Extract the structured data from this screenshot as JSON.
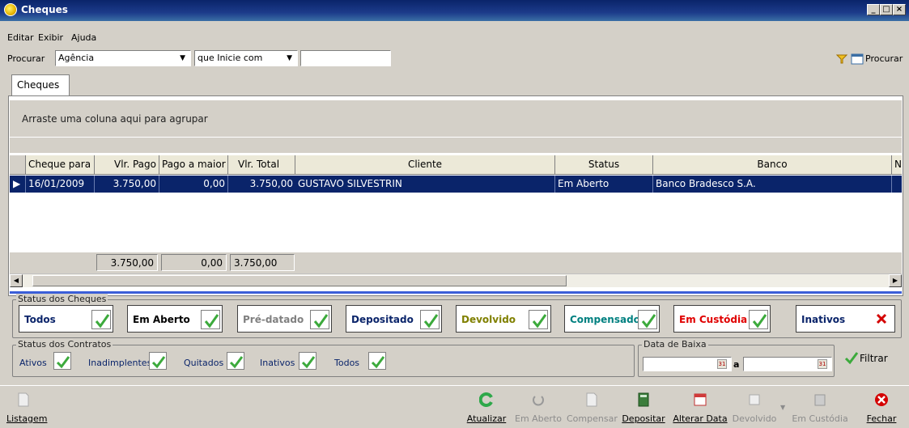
{
  "window": {
    "title": "Cheques",
    "controls": [
      "_",
      "□",
      "×"
    ]
  },
  "menu": [
    "Editar",
    "Exibir",
    "Ajuda"
  ],
  "search": {
    "label": "Procurar",
    "field": "Agência",
    "condition": "que Inicie com",
    "value": "",
    "button": "Procurar"
  },
  "tabs": [
    "Cheques"
  ],
  "grid": {
    "group_hint": "Arraste uma coluna aqui para agrupar",
    "columns": [
      "Cheque para",
      "Vlr. Pago",
      "Pago a maior",
      "Vlr. Total",
      "Cliente",
      "Status",
      "Banco",
      "N"
    ],
    "rows": [
      {
        "cheque_para": "16/01/2009",
        "vlr_pago": "3.750,00",
        "pago_a_maior": "0,00",
        "vlr_total": "3.750,00",
        "cliente": "GUSTAVO SILVESTRIN",
        "status": "Em Aberto",
        "banco": "Banco Bradesco S.A.",
        "n": ""
      }
    ],
    "totals": {
      "vlr_pago": "3.750,00",
      "pago_a_maior": "0,00",
      "vlr_total": "3.750,00"
    }
  },
  "status_cheques": {
    "legend": "Status dos Cheques",
    "items": [
      {
        "label": "Todos",
        "color": "#0a246a",
        "checked": true
      },
      {
        "label": "Em Aberto",
        "color": "#000000",
        "checked": true
      },
      {
        "label": "Pré-datado",
        "color": "#808080",
        "checked": true
      },
      {
        "label": "Depositado",
        "color": "#0a246a",
        "checked": true
      },
      {
        "label": "Devolvido",
        "color": "#808000",
        "checked": true
      },
      {
        "label": "Compensado",
        "color": "#008080",
        "checked": true
      },
      {
        "label": "Em Custódia",
        "color": "#e00000",
        "checked": true
      },
      {
        "label": "Inativos",
        "color": "#0a246a",
        "checked": false
      }
    ]
  },
  "status_contratos": {
    "legend": "Status dos Contratos",
    "items": [
      "Ativos",
      "Inadimplentes",
      "Quitados",
      "Inativos",
      "Todos"
    ]
  },
  "data_baixa": {
    "legend": "Data de Baixa",
    "from": "",
    "separator": "a",
    "to": ""
  },
  "filter_button": "Filtrar",
  "toolbar": {
    "listagem": "Listagem",
    "atualizar": "Atualizar",
    "em_aberto": "Em Aberto",
    "compensar": "Compensar",
    "depositar": "Depositar",
    "alterar_data": "Alterar Data",
    "devolvido": "Devolvido",
    "em_custodia": "Em Custódia",
    "fechar": "Fechar"
  },
  "colors": {
    "title_bar": "#0a246a",
    "selection": "#0a246a",
    "check": "#3caa3c",
    "close": "#d40000"
  }
}
